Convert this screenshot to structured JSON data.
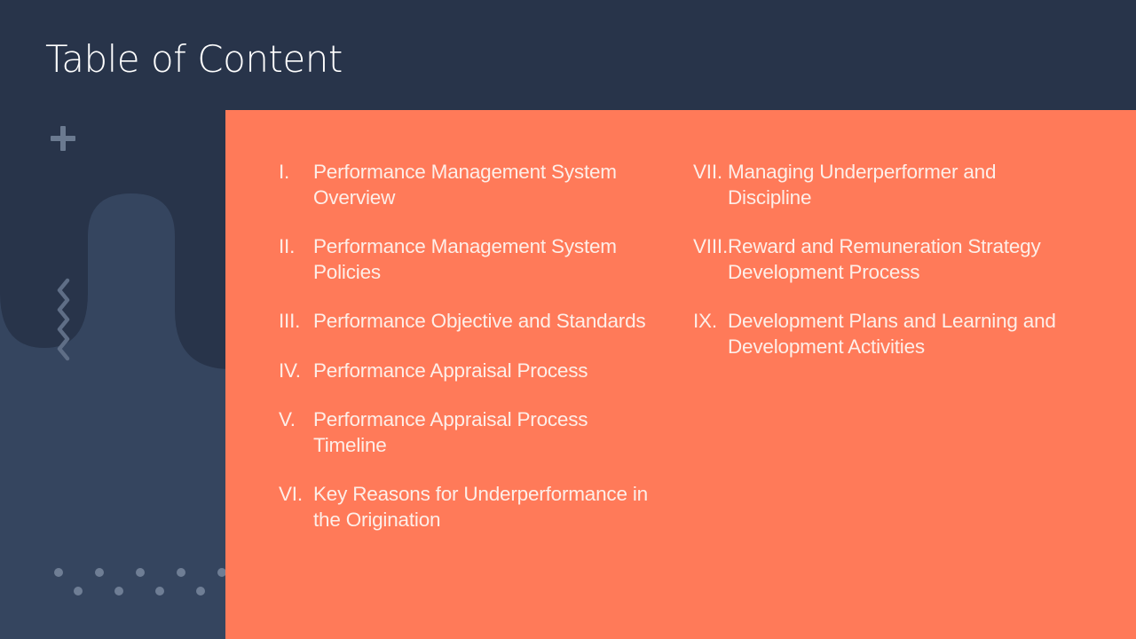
{
  "slide": {
    "title": "Table of Content",
    "colors": {
      "background_dark": "#28344a",
      "background_mid": "#35455f",
      "panel_accent": "#ff7a59",
      "decoration": "#6b7a90",
      "text_light": "#fdeee8"
    },
    "decorations": [
      "plus-icon",
      "zigzag-icon",
      "dot-pattern"
    ]
  },
  "toc": {
    "left_column": [
      {
        "numeral": "I.",
        "label": "Performance Management System Overview"
      },
      {
        "numeral": "II.",
        "label": "Performance Management System Policies"
      },
      {
        "numeral": "III.",
        "label": "Performance Objective and Standards"
      },
      {
        "numeral": "IV.",
        "label": "Performance Appraisal Process"
      },
      {
        "numeral": "V.",
        "label": "Performance Appraisal Process Timeline"
      },
      {
        "numeral": "VI.",
        "label": "Key Reasons for Underperformance in the Origination"
      }
    ],
    "right_column": [
      {
        "numeral": "VII.",
        "label": "Managing Underperformer and Discipline"
      },
      {
        "numeral": "VIII.",
        "label": "Reward and Remuneration Strategy Development Process"
      },
      {
        "numeral": "IX.",
        "label": "Development Plans and Learning and Development Activities"
      }
    ]
  }
}
